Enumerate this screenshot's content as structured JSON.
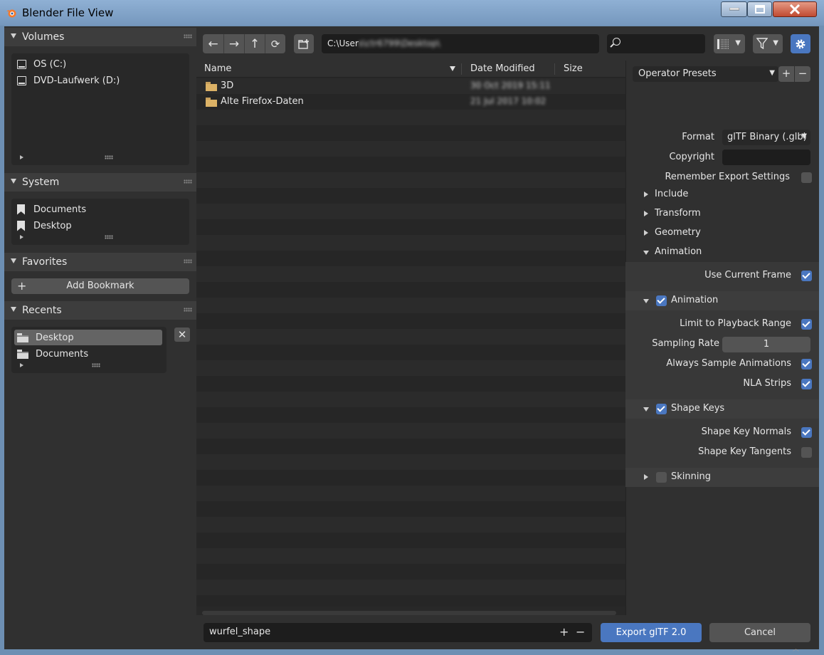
{
  "window": {
    "title": "Blender File View"
  },
  "sidebar": {
    "volumes": {
      "title": "Volumes",
      "items": [
        {
          "label": "OS (C:)",
          "icon": "disk-icon"
        },
        {
          "label": "DVD-Laufwerk (D:)",
          "icon": "disk-icon"
        }
      ]
    },
    "system": {
      "title": "System",
      "items": [
        {
          "label": "Documents",
          "icon": "bookmark-icon"
        },
        {
          "label": "Desktop",
          "icon": "bookmark-icon"
        }
      ]
    },
    "favorites": {
      "title": "Favorites",
      "add_bookmark": "Add Bookmark"
    },
    "recents": {
      "title": "Recents",
      "items": [
        {
          "label": "Desktop",
          "icon": "folder-icon",
          "selected": true
        },
        {
          "label": "Documents",
          "icon": "folder-icon",
          "selected": false
        }
      ]
    }
  },
  "toolbar": {
    "path_prefix": "C:\\User",
    "path_blurred": "s\\ctr6799\\Desktop\\"
  },
  "columns": {
    "name": "Name",
    "date": "Date Modified",
    "size": "Size"
  },
  "files": [
    {
      "name": "3D",
      "date": "30 Oct 2019 15:11"
    },
    {
      "name": "Alte Firefox-Daten",
      "date": "21 Jul 2017 10:02"
    }
  ],
  "bottom": {
    "filename": "wurfel_shape",
    "export_label": "Export glTF 2.0",
    "cancel_label": "Cancel"
  },
  "settings": {
    "operator_presets": "Operator Presets",
    "format_label": "Format",
    "format_value": "glTF Binary (.glb)",
    "copyright_label": "Copyright",
    "copyright_value": "",
    "remember_label": "Remember Export Settings",
    "remember_checked": false,
    "include": "Include",
    "transform": "Transform",
    "geometry": "Geometry",
    "animation": "Animation",
    "use_current_frame": "Use Current Frame",
    "use_current_frame_checked": true,
    "animation_sub": "Animation",
    "animation_sub_checked": true,
    "limit_playback": "Limit to Playback Range",
    "limit_playback_checked": true,
    "sampling_rate_label": "Sampling Rate",
    "sampling_rate_value": "1",
    "always_sample": "Always Sample Animations",
    "always_sample_checked": true,
    "nla_strips": "NLA Strips",
    "nla_strips_checked": true,
    "shape_keys": "Shape Keys",
    "shape_keys_checked": true,
    "shape_key_normals": "Shape Key Normals",
    "shape_key_normals_checked": true,
    "shape_key_tangents": "Shape Key Tangents",
    "shape_key_tangents_checked": false,
    "skinning": "Skinning",
    "skinning_checked": false
  },
  "colors": {
    "accent": "#4a77c0",
    "folder": "#dcb266"
  }
}
